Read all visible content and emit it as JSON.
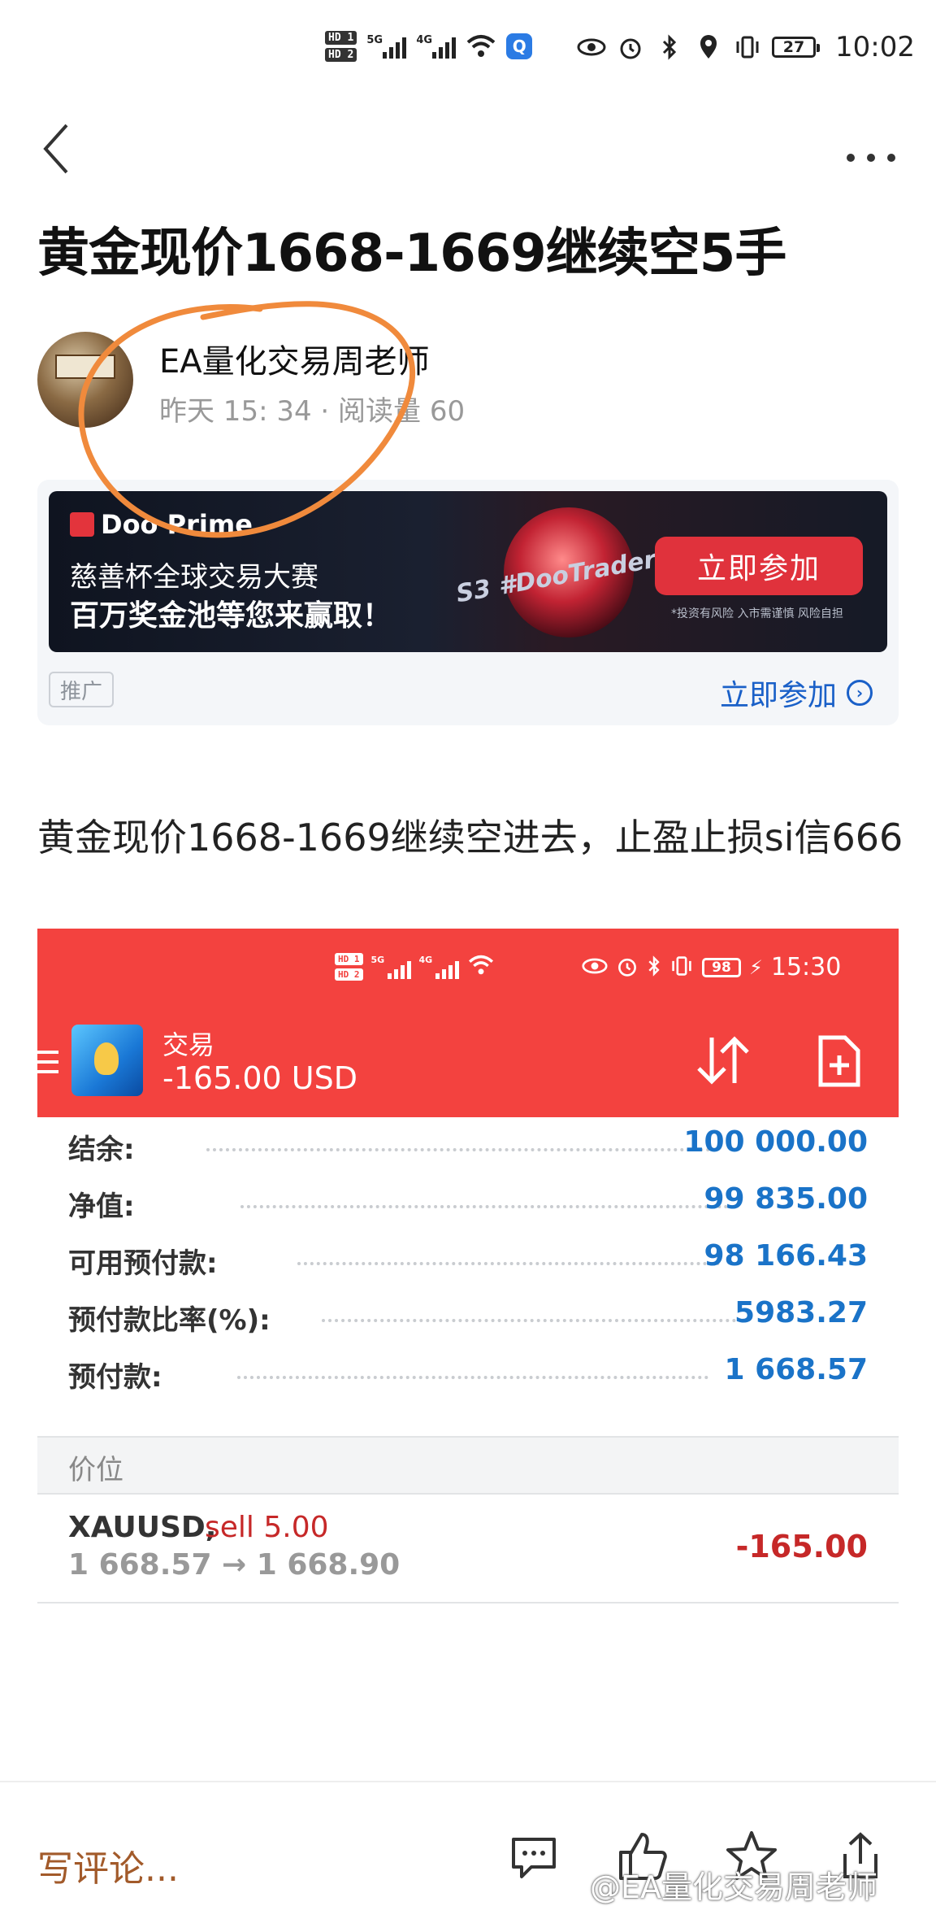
{
  "status_bar": {
    "sim1": "HD 1",
    "sim2": "HD 2",
    "network1": "5G",
    "network2": "4G",
    "battery": "27",
    "time": "10:02"
  },
  "article": {
    "title": "黄金现价1668-1669继续空5手",
    "author": "EA量化交易周老师",
    "meta": "昨天 15: 34 · 阅读量 60",
    "body": "黄金现价1668-1669继续空进去，止盈止损si信666"
  },
  "ad": {
    "brand": "Doo Prime",
    "line1": "慈善杯全球交易大赛",
    "line2": "百万奖金池等您来赢取！",
    "badge_text": "S3 #DooTrader",
    "button": "立即参加",
    "risk_note": "*投资有风险 入市需谨慎 风险自担",
    "tag": "推广",
    "link": "立即参加"
  },
  "embedded": {
    "status": {
      "sim1": "HD 1",
      "sim2": "HD 2",
      "network1": "5G",
      "network2": "4G",
      "battery": "98",
      "time": "15:30"
    },
    "header": {
      "label": "交易",
      "amount": "-165.00 USD"
    },
    "account": [
      {
        "label": "结余:",
        "value": "100 000.00"
      },
      {
        "label": "净值:",
        "value": "99 835.00"
      },
      {
        "label": "可用预付款:",
        "value": "98 166.43"
      },
      {
        "label": "预付款比率(%):",
        "value": "5983.27"
      },
      {
        "label": "预付款:",
        "value": "1 668.57"
      }
    ],
    "section": "价位",
    "position": {
      "symbol": "XAUUSD,",
      "side": "sell 5.00",
      "prices": "1 668.57 → 1 668.90",
      "profit": "-165.00"
    }
  },
  "bottom": {
    "comment_placeholder": "写评论...",
    "watermark": "@EA量化交易周老师"
  },
  "colors": {
    "accent_red": "#f3423f",
    "value_blue": "#1a73c8",
    "loss_red": "#c62828",
    "link_blue": "#1a60c8",
    "annotation_orange": "#f08a3c"
  }
}
